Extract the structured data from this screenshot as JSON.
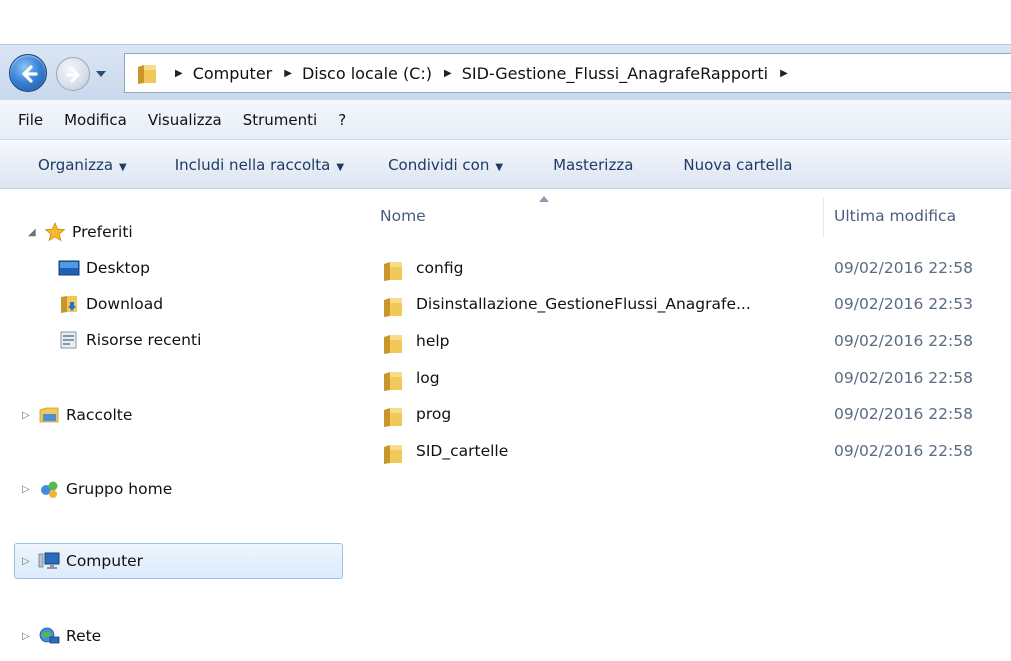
{
  "address": {
    "crumbs": [
      "Computer",
      "Disco locale (C:)",
      "SID-Gestione_Flussi_AnagrafeRapporti"
    ]
  },
  "menu": [
    "File",
    "Modifica",
    "Visualizza",
    "Strumenti",
    "?"
  ],
  "toolbar": {
    "organize": "Organizza",
    "include": "Includi nella raccolta",
    "share": "Condividi con",
    "burn": "Masterizza",
    "new_folder": "Nuova cartella"
  },
  "nav": {
    "favorites": "Preferiti",
    "desktop": "Desktop",
    "download": "Download",
    "recent": "Risorse recenti",
    "libraries": "Raccolte",
    "homegroup": "Gruppo home",
    "computer": "Computer",
    "network": "Rete"
  },
  "columns": {
    "name": "Nome",
    "modified": "Ultima modifica"
  },
  "files": [
    {
      "name": "config",
      "modified": "09/02/2016 22:58"
    },
    {
      "name": "Disinstallazione_GestioneFlussi_Anagrafe...",
      "modified": "09/02/2016 22:53"
    },
    {
      "name": "help",
      "modified": "09/02/2016 22:58"
    },
    {
      "name": "log",
      "modified": "09/02/2016 22:58"
    },
    {
      "name": "prog",
      "modified": "09/02/2016 22:58"
    },
    {
      "name": "SID_cartelle",
      "modified": "09/02/2016 22:58"
    }
  ],
  "icons": {
    "folder": "folder-icon",
    "favorites": "star-icon",
    "desktop": "desktop-icon",
    "download": "download-folder-icon",
    "recent": "recent-places-icon",
    "libraries": "libraries-icon",
    "homegroup": "homegroup-icon",
    "computer": "computer-icon",
    "network": "network-icon"
  },
  "colors": {
    "accent": "#3a84d8",
    "selection": "#dcebfc",
    "folder": "#e8b93c"
  }
}
